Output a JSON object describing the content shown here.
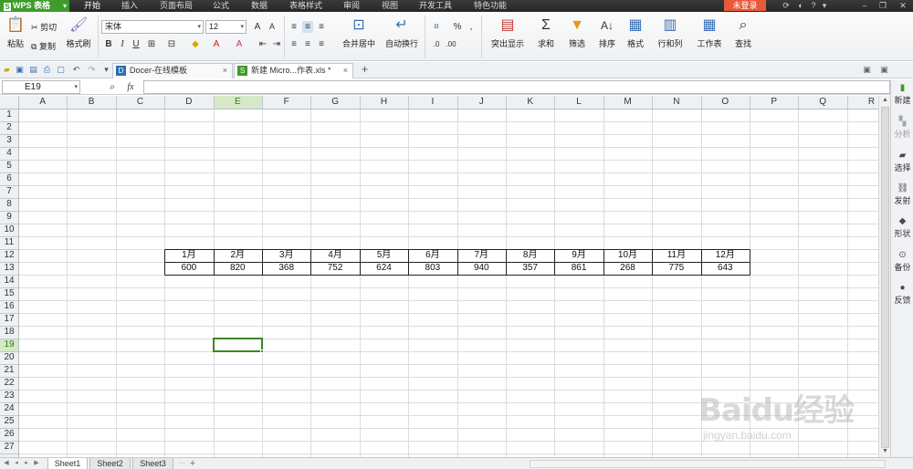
{
  "menubar": {
    "app_name": "WPS 表格",
    "tabs": [
      "开始",
      "插入",
      "页面布局",
      "公式",
      "数据",
      "表格样式",
      "审阅",
      "视图",
      "开发工具",
      "特色功能"
    ],
    "login": "未登录"
  },
  "ribbon": {
    "paste": "粘贴",
    "cut": "剪切",
    "copy": "复制",
    "format_painter": "格式刷",
    "font_name": "宋体",
    "font_size": "12",
    "merge_center": "合并居中",
    "wrap_text": "自动换行",
    "conditional_format": "突出显示",
    "sum": "求和",
    "filter": "筛选",
    "sort": "排序",
    "format": "格式",
    "rows_cols": "行和列",
    "worksheet": "工作表",
    "find": "查找"
  },
  "doc_tabs": [
    {
      "label": "Docer-在线模板",
      "close": "×"
    },
    {
      "label": "新建 Micro...作表.xls *",
      "close": "×"
    }
  ],
  "formula_bar": {
    "name_box": "E19",
    "fx": "fx",
    "formula": ""
  },
  "grid": {
    "columns": [
      "A",
      "B",
      "C",
      "D",
      "E",
      "F",
      "G",
      "H",
      "I",
      "J",
      "K",
      "L",
      "M",
      "N",
      "O",
      "P",
      "Q",
      "R"
    ],
    "rows": [
      "1",
      "2",
      "3",
      "4",
      "5",
      "6",
      "7",
      "8",
      "9",
      "10",
      "11",
      "12",
      "13",
      "14",
      "15",
      "16",
      "17",
      "18",
      "19",
      "20",
      "21",
      "22",
      "23",
      "24",
      "25",
      "26",
      "27"
    ],
    "active_cell": "E19",
    "table": {
      "header_row": 12,
      "value_row": 13,
      "start_column": "D",
      "months": [
        "1月",
        "2月",
        "3月",
        "4月",
        "5月",
        "6月",
        "7月",
        "8月",
        "9月",
        "10月",
        "11月",
        "12月"
      ],
      "values": [
        "600",
        "820",
        "368",
        "752",
        "624",
        "803",
        "940",
        "357",
        "861",
        "268",
        "775",
        "643"
      ]
    }
  },
  "side_panel": [
    "新建",
    "分析",
    "选择",
    "发射",
    "形状",
    "备份",
    "反馈"
  ],
  "sheet_tabs": [
    "Sheet1",
    "Sheet2",
    "Sheet3"
  ],
  "active_sheet": "Sheet1",
  "watermark": {
    "main": "Baidu经验",
    "sub": "jingyan.baidu.com"
  },
  "colors": {
    "accent_green": "#3f9b2c",
    "active_cell": "#3a8a22",
    "login": "#e8583a"
  }
}
